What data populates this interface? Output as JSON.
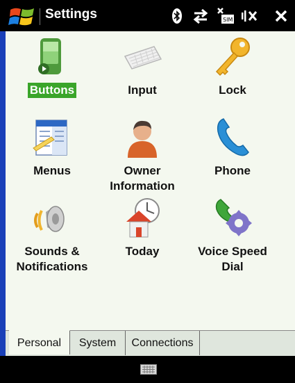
{
  "window": {
    "title": "Settings"
  },
  "status_icons": [
    "bluetooth-icon",
    "connectivity-arrows-icon",
    "no-sim-icon",
    "speaker-muted-icon",
    "close-icon"
  ],
  "items": [
    {
      "label": "Buttons",
      "icon": "device-buttons-icon",
      "selected": true
    },
    {
      "label": "Input",
      "icon": "keyboard-icon"
    },
    {
      "label": "Lock",
      "icon": "key-icon"
    },
    {
      "label": "Menus",
      "icon": "menu-document-icon"
    },
    {
      "label_line1": "Owner",
      "label_line2": "Information",
      "icon": "person-icon"
    },
    {
      "label": "Phone",
      "icon": "phone-handset-icon"
    },
    {
      "label_line1": "Sounds &",
      "label_line2": "Notifications",
      "icon": "speaker-icon"
    },
    {
      "label": "Today",
      "icon": "home-clock-icon"
    },
    {
      "label_line1": "Voice Speed",
      "label_line2": "Dial",
      "icon": "phone-gear-icon"
    }
  ],
  "tabs": [
    {
      "label": "Personal",
      "active": true
    },
    {
      "label": "System"
    },
    {
      "label": "Connections"
    }
  ],
  "bottom": {
    "keyboard": "keyboard-toggle-icon"
  },
  "colors": {
    "accent_selected": "#3aa52a",
    "content_bg": "#f4f8ef",
    "left_strip": "#1a40b8"
  }
}
